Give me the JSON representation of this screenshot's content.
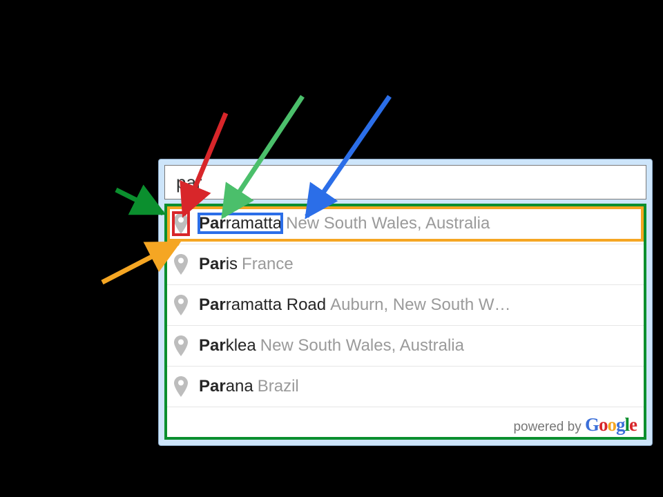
{
  "search": {
    "value": "par"
  },
  "suggestions": [
    {
      "typed": "Par",
      "rest": "ramatta",
      "secondary": "New South Wales, Australia"
    },
    {
      "typed": "Par",
      "rest": "is",
      "secondary": "France"
    },
    {
      "typed": "Par",
      "rest": "ramatta Road",
      "secondary": "Auburn, New South W…"
    },
    {
      "typed": "Par",
      "rest": "klea",
      "secondary": "New South Wales, Australia"
    },
    {
      "typed": "Par",
      "rest": "ana",
      "secondary": "Brazil"
    }
  ],
  "attribution": {
    "prefix": "powered by ",
    "brand": "Google"
  },
  "brand_colors": {
    "G": "#3b6fd8",
    "o1": "#d8262a",
    "o2": "#f5a623",
    "g": "#3b6fd8",
    "l": "#0b8f2e",
    "e": "#d8262a"
  },
  "annotations": {
    "boxes": {
      "dropdown_container": "green",
      "first_row": "orange",
      "pin_icon": "red",
      "matched_text": "blue"
    },
    "arrows": {
      "to_dropdown": "green",
      "to_pin": "red",
      "to_matched": "green-light",
      "to_row": "orange",
      "to_secondary": "blue"
    }
  }
}
